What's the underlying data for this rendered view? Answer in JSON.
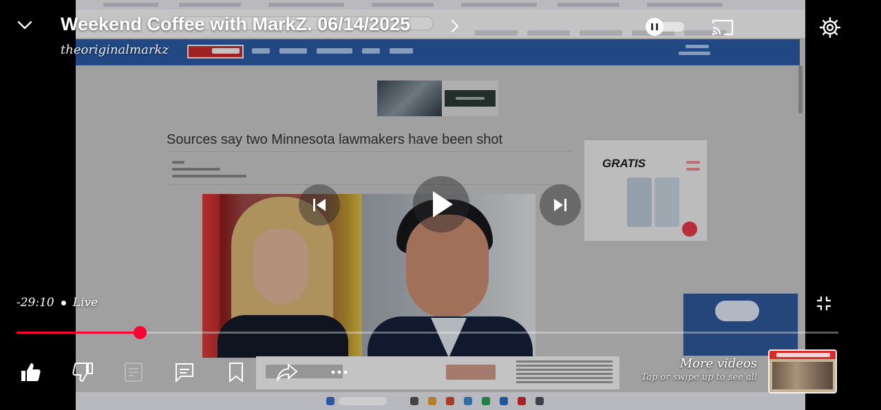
{
  "player": {
    "title": "Weekend Coffee with MarkZ. 06/14/2025",
    "channel": "theoriginalmarkz",
    "time_remaining": "-29:10",
    "live_label": "Live",
    "progress_fraction": 0.15,
    "more_videos": {
      "title": "More videos",
      "hint": "Tap or swipe up to see all"
    }
  },
  "frame": {
    "headline": "Sources say two Minnesota lawmakers have been shot",
    "side_ad_text": "GRATIS"
  },
  "icons": {
    "collapse": "chevron-down-icon",
    "title_more": "chevron-right-icon",
    "autoplay": "autoplay-toggle-icon",
    "cast": "cast-icon",
    "settings": "gear-icon",
    "previous": "skip-previous-icon",
    "play": "play-icon",
    "next": "skip-next-icon",
    "fullscreen_exit": "exit-fullscreen-icon",
    "like": "thumbs-up-icon",
    "dislike": "thumbs-down-icon",
    "description": "description-icon",
    "comments": "comment-icon",
    "save": "bookmark-icon",
    "share": "share-icon",
    "more": "more-horizontal-icon"
  },
  "colors": {
    "progress": "#ff0033",
    "site_nav": "#2b5aa6"
  }
}
